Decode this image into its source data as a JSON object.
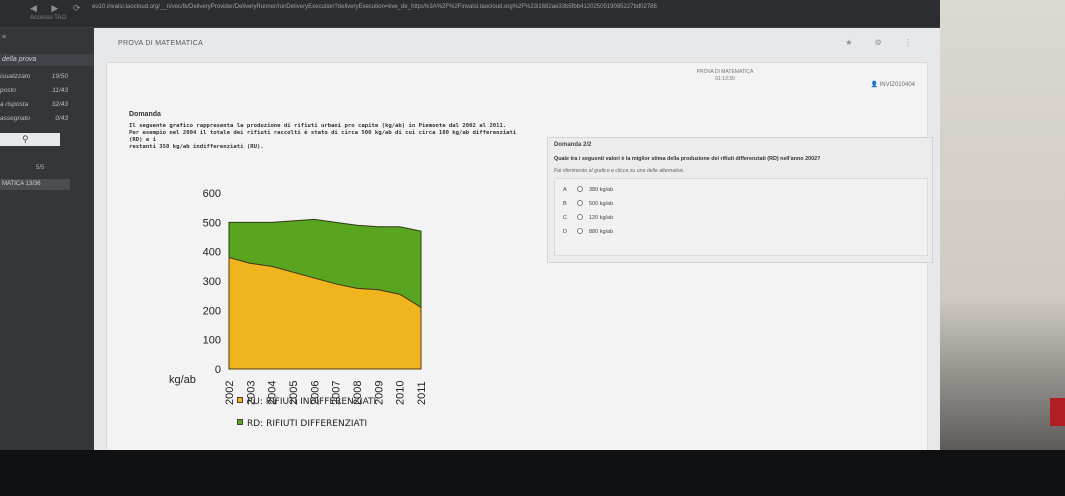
{
  "browser": {
    "url": "eu10.invalsi.taocloud.org/__n/vec/tk/DeliveryProvider/DeliveryRunner/runDeliveryExecution?deliveryExecution=kve_de_https%3A%2F%2Finvalsi.taocloud.org%2F%23i1682ae33b5fbb4120250519095227bd02786",
    "tab_label": "Accesso TAO"
  },
  "sidebar": {
    "header": "della prova",
    "rows": [
      {
        "label": "isualizzato",
        "value": "19/50"
      },
      {
        "label": "posto",
        "value": "11/43"
      },
      {
        "label": "a risposta",
        "value": "32/43"
      },
      {
        "label": "assegnato",
        "value": "0/43"
      }
    ],
    "counter": "5/5",
    "current_item": "MATICA 13/36"
  },
  "app": {
    "title": "PROVA DI MATEMATICA",
    "meta_title": "PROVA DI MATEMATICA",
    "meta_time": "01:13:30",
    "user_button": "INVIZ010404"
  },
  "question": {
    "domanda_label": "Domanda",
    "stem_line1": "Il seguente grafico rappresenta la produzione di rifiuti urbani pro capite (kg/ab) in Piemonte dal 2002 al 2011.",
    "stem_line2": "Per esempio nel 2004 il totale dei rifiuti raccolti è stato di circa 500 kg/ab di cui circa 180 kg/ab differenziati (RD) e i",
    "stem_line3": "restanti 350 kg/ab indifferenziati (RU).",
    "panel_header": "Domanda 2/2",
    "panel_question": "Quale tra i seguenti valori è la miglior stima della produzione dei rifiuti differenziati (RD) nell'anno 2002?",
    "panel_instruction": "Fai riferimento al grafico e clicca su una delle alternative.",
    "options": [
      {
        "letter": "A",
        "text": "380 kg/ab"
      },
      {
        "letter": "B",
        "text": "500 kg/ab"
      },
      {
        "letter": "C",
        "text": "120 kg/ab"
      },
      {
        "letter": "D",
        "text": "880 kg/ab"
      }
    ]
  },
  "legend": {
    "ru": "RU: RIFIUTI INDIFFERENZIATI",
    "rd": "RD: RIFIUTI DIFFERENZIATI"
  },
  "colors": {
    "ru": "#f0b51e",
    "rd": "#5aa51f"
  },
  "chart_data": {
    "type": "area",
    "x": [
      "2002",
      "2003",
      "2004",
      "2005",
      "2006",
      "2007",
      "2008",
      "2009",
      "2010",
      "2011"
    ],
    "ylabel": "kg/ab",
    "ylim": [
      0,
      600
    ],
    "yticks": [
      0,
      100,
      200,
      300,
      400,
      500,
      600
    ],
    "series": [
      {
        "name": "RU: RIFIUTI INDIFFERENZIATI",
        "values": [
          380,
          360,
          350,
          330,
          310,
          290,
          275,
          270,
          255,
          210
        ]
      },
      {
        "name": "RD: RIFIUTI DIFFERENZIATI",
        "values": [
          120,
          140,
          150,
          175,
          200,
          210,
          215,
          215,
          230,
          260
        ]
      }
    ],
    "stacked": true
  }
}
